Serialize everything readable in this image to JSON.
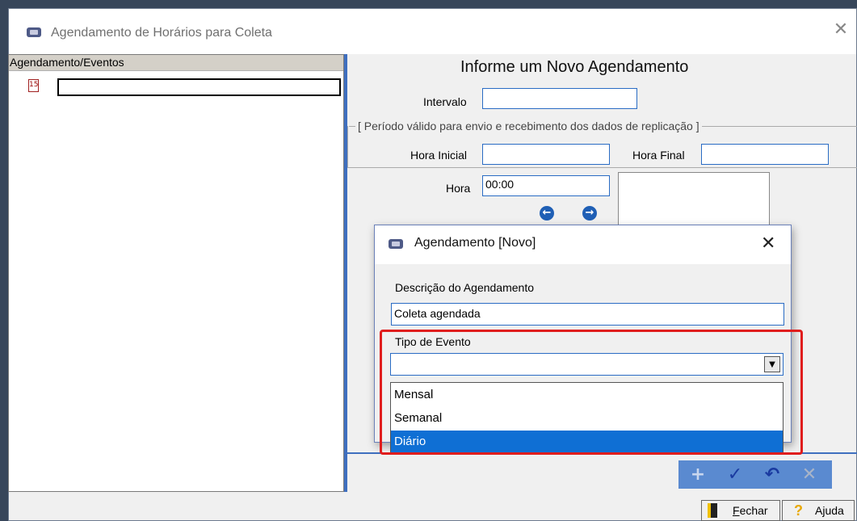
{
  "window": {
    "title": "Agendamento de Horários para Coleta",
    "close_glyph": "✕"
  },
  "tree": {
    "header": "Agendamento/Eventos",
    "icon_text": "15",
    "edit_value": ""
  },
  "form": {
    "title": "Informe um Novo Agendamento",
    "intervalo_label": "Intervalo",
    "intervalo_value": "",
    "group_caption": "[ Período válido para envio e recebimento dos dados de replicação ]",
    "hora_inicial_label": "Hora Inicial",
    "hora_inicial_value": "",
    "hora_final_label": "Hora Final",
    "hora_final_value": "",
    "hora_label": "Hora",
    "hora_value": "00:00",
    "nav_left": "←",
    "nav_right": "→"
  },
  "toolbar": {
    "add": "+",
    "confirm": "✓",
    "undo": "↶",
    "cancel": "✕",
    "colors": {
      "bg": "#5a8ad0",
      "confirm": "#1a3aa0",
      "add": "#c8d6ee",
      "cancel": "#a8b4c8"
    }
  },
  "bottom": {
    "fechar_label": "Fechar",
    "fechar_accel": "F",
    "fechar_rest": "echar",
    "ajuda_label": "Ajuda",
    "ajuda_icon": "?"
  },
  "dialog": {
    "title": "Agendamento [Novo]",
    "close_glyph": "✕",
    "descricao_label": "Descrição do Agendamento",
    "descricao_value": "Coleta agendada",
    "tipo_label": "Tipo de Evento",
    "tipo_value": "",
    "options": [
      "Mensal",
      "Semanal",
      "Diário"
    ],
    "selected_option": "Diário"
  },
  "icons": [
    "app-icon",
    "calendar-icon",
    "arrow-left-icon",
    "arrow-right-icon",
    "add-icon",
    "check-icon",
    "undo-icon",
    "cancel-icon",
    "door-icon",
    "help-icon",
    "chevron-down-icon"
  ],
  "colors": {
    "accent": "#2a6cc4",
    "selection": "#0f6fd4",
    "highlight": "#e01d1d"
  }
}
